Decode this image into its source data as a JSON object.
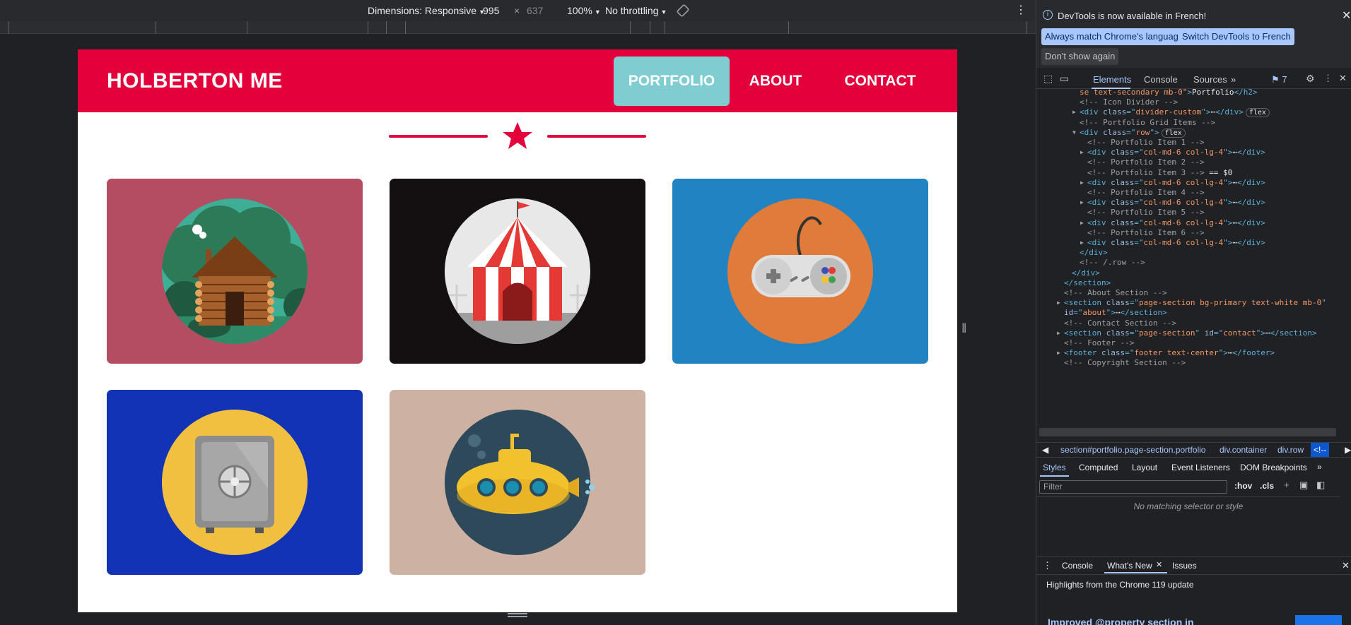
{
  "device_toolbar": {
    "dimensions_label": "Dimensions: Responsive",
    "width_value": "995",
    "times": "×",
    "height_value": "637",
    "zoom_label": "100%",
    "throttling_label": "No throttling",
    "rotate_icon": "rotate-icon",
    "more_icon": "kebab-menu-icon"
  },
  "page": {
    "brand": "HOLBERTON ME",
    "nav": [
      {
        "label": "PORTFOLIO",
        "active": true
      },
      {
        "label": "ABOUT",
        "active": false
      },
      {
        "label": "CONTACT",
        "active": false
      }
    ],
    "accent_color": "#e4003b",
    "active_nav_color": "#7fcdd1",
    "divider_icon": "star-icon",
    "portfolio_items": [
      {
        "name": "cabin",
        "bg": "#b44d62",
        "icon": "log-cabin-icon"
      },
      {
        "name": "circus",
        "bg": "#141011",
        "icon": "circus-tent-icon"
      },
      {
        "name": "game",
        "bg": "#2283c2",
        "icon": "game-controller-icon"
      },
      {
        "name": "safe",
        "bg": "#1233b5",
        "icon": "safe-icon"
      },
      {
        "name": "submarine",
        "bg": "#cdb1a3",
        "icon": "submarine-icon"
      }
    ]
  },
  "devtools": {
    "banner_text": "DevTools is now available in French!",
    "btn_match": "Always match Chrome's language",
    "btn_switch": "Switch DevTools to French",
    "btn_dont_show": "Don't show again",
    "tabs": [
      "Elements",
      "Console",
      "Sources"
    ],
    "issues_count": "7",
    "code_lines": [
      {
        "indent": 1,
        "parts": [
          [
            "av",
            "se text-secondary mb-0\""
          ],
          [
            "tg",
            ">"
          ],
          [
            "txt",
            "Portfolio"
          ],
          [
            "tg",
            "</h2>"
          ]
        ]
      },
      {
        "indent": 1,
        "parts": [
          [
            "cm",
            "<!-- Icon Divider -->"
          ]
        ]
      },
      {
        "indent": 1,
        "arrow": "▶",
        "parts": [
          [
            "tg",
            "<div "
          ],
          [
            "at",
            "class"
          ],
          [
            "tg",
            "=\""
          ],
          [
            "av",
            "divider-custom"
          ],
          [
            "tg",
            "\">"
          ],
          [
            "txt",
            "⋯"
          ],
          [
            "tg",
            "</div>"
          ]
        ],
        "badge": "flex"
      },
      {
        "indent": 1,
        "parts": [
          [
            "cm",
            "<!-- Portfolio Grid Items -->"
          ]
        ]
      },
      {
        "indent": 1,
        "arrow": "▼",
        "parts": [
          [
            "tg",
            "<div "
          ],
          [
            "at",
            "class"
          ],
          [
            "tg",
            "=\""
          ],
          [
            "av",
            "row"
          ],
          [
            "tg",
            "\">"
          ]
        ],
        "badge": "flex"
      },
      {
        "indent": 2,
        "parts": [
          [
            "cm",
            "<!-- Portfolio Item 1 -->"
          ]
        ]
      },
      {
        "indent": 2,
        "arrow": "▶",
        "parts": [
          [
            "tg",
            "<div "
          ],
          [
            "at",
            "class"
          ],
          [
            "tg",
            "=\""
          ],
          [
            "av",
            "col-md-6 col-lg-4"
          ],
          [
            "tg",
            "\">"
          ],
          [
            "txt",
            "⋯"
          ],
          [
            "tg",
            "</div>"
          ]
        ]
      },
      {
        "indent": 2,
        "parts": [
          [
            "cm",
            "<!-- Portfolio Item 2 -->"
          ]
        ]
      },
      {
        "indent": 2,
        "parts": [
          [
            "cm",
            "<!-- Portfolio Item 3 --> "
          ],
          [
            "txt",
            "== $0"
          ]
        ]
      },
      {
        "indent": 2,
        "arrow": "▶",
        "parts": [
          [
            "tg",
            "<div "
          ],
          [
            "at",
            "class"
          ],
          [
            "tg",
            "=\""
          ],
          [
            "av",
            "col-md-6 col-lg-4"
          ],
          [
            "tg",
            "\">"
          ],
          [
            "txt",
            "⋯"
          ],
          [
            "tg",
            "</div>"
          ]
        ]
      },
      {
        "indent": 2,
        "parts": [
          [
            "cm",
            "<!-- Portfolio Item 4 -->"
          ]
        ]
      },
      {
        "indent": 2,
        "arrow": "▶",
        "parts": [
          [
            "tg",
            "<div "
          ],
          [
            "at",
            "class"
          ],
          [
            "tg",
            "=\""
          ],
          [
            "av",
            "col-md-6 col-lg-4"
          ],
          [
            "tg",
            "\">"
          ],
          [
            "txt",
            "⋯"
          ],
          [
            "tg",
            "</div>"
          ]
        ]
      },
      {
        "indent": 2,
        "parts": [
          [
            "cm",
            "<!-- Portfolio Item 5 -->"
          ]
        ]
      },
      {
        "indent": 2,
        "arrow": "▶",
        "parts": [
          [
            "tg",
            "<div "
          ],
          [
            "at",
            "class"
          ],
          [
            "tg",
            "=\""
          ],
          [
            "av",
            "col-md-6 col-lg-4"
          ],
          [
            "tg",
            "\">"
          ],
          [
            "txt",
            "⋯"
          ],
          [
            "tg",
            "</div>"
          ]
        ]
      },
      {
        "indent": 2,
        "parts": [
          [
            "cm",
            "<!-- Portfolio Item 6 -->"
          ]
        ]
      },
      {
        "indent": 2,
        "arrow": "▶",
        "parts": [
          [
            "tg",
            "<div "
          ],
          [
            "at",
            "class"
          ],
          [
            "tg",
            "=\""
          ],
          [
            "av",
            "col-md-6 col-lg-4"
          ],
          [
            "tg",
            "\">"
          ],
          [
            "txt",
            "⋯"
          ],
          [
            "tg",
            "</div>"
          ]
        ]
      },
      {
        "indent": 1,
        "parts": [
          [
            "tg",
            "</div>"
          ]
        ]
      },
      {
        "indent": 1,
        "parts": [
          [
            "cm",
            "<!-- /.row -->"
          ]
        ]
      },
      {
        "indent": 0,
        "parts": [
          [
            "tg",
            "</div>"
          ]
        ]
      },
      {
        "indent": -1,
        "parts": [
          [
            "tg",
            "</section>"
          ]
        ]
      },
      {
        "indent": -1,
        "parts": [
          [
            "cm",
            "<!-- About Section -->"
          ]
        ]
      },
      {
        "indent": -1,
        "arrow": "▶",
        "parts": [
          [
            "tg",
            "<section "
          ],
          [
            "at",
            "class"
          ],
          [
            "tg",
            "=\""
          ],
          [
            "av",
            "page-section bg-primary text-white mb-0"
          ],
          [
            "tg",
            "\""
          ]
        ]
      },
      {
        "indent": -1,
        "parts": [
          [
            "at",
            "id"
          ],
          [
            "tg",
            "=\""
          ],
          [
            "av",
            "about"
          ],
          [
            "tg",
            "\">"
          ],
          [
            "txt",
            "⋯"
          ],
          [
            "tg",
            "</section>"
          ]
        ]
      },
      {
        "indent": -1,
        "parts": [
          [
            "cm",
            "<!-- Contact Section -->"
          ]
        ]
      },
      {
        "indent": -1,
        "arrow": "▶",
        "parts": [
          [
            "tg",
            "<section "
          ],
          [
            "at",
            "class"
          ],
          [
            "tg",
            "=\""
          ],
          [
            "av",
            "page-section"
          ],
          [
            "tg",
            "\" "
          ],
          [
            "at",
            "id"
          ],
          [
            "tg",
            "=\""
          ],
          [
            "av",
            "contact"
          ],
          [
            "tg",
            "\">"
          ],
          [
            "txt",
            "⋯"
          ],
          [
            "tg",
            "</section>"
          ]
        ]
      },
      {
        "indent": -1,
        "parts": [
          [
            "cm",
            "<!-- Footer -->"
          ]
        ]
      },
      {
        "indent": -1,
        "arrow": "▶",
        "parts": [
          [
            "tg",
            "<footer "
          ],
          [
            "at",
            "class"
          ],
          [
            "tg",
            "=\""
          ],
          [
            "av",
            "footer text-center"
          ],
          [
            "tg",
            "\">"
          ],
          [
            "txt",
            "⋯"
          ],
          [
            "tg",
            "</footer>"
          ]
        ]
      },
      {
        "indent": -1,
        "parts": [
          [
            "cm",
            "<!-- Copyright Section -->"
          ]
        ]
      }
    ],
    "breadcrumbs": [
      {
        "text": "section#portfolio.page-section.portfolio"
      },
      {
        "text": "div.container"
      },
      {
        "text": "div.row"
      },
      {
        "text": "<!--"
      }
    ],
    "styles_tabs": [
      "Styles",
      "Computed",
      "Layout",
      "Event Listeners",
      "DOM Breakpoints"
    ],
    "filter_placeholder": "Filter",
    "hov": ":hov",
    "cls": ".cls",
    "no_match": "No matching selector or style",
    "drawer_tabs": [
      "Console",
      "What's New",
      "Issues"
    ],
    "drawer_highlight": "Highlights from the Chrome 119 update",
    "drawer_link": "Improved @property section in"
  }
}
